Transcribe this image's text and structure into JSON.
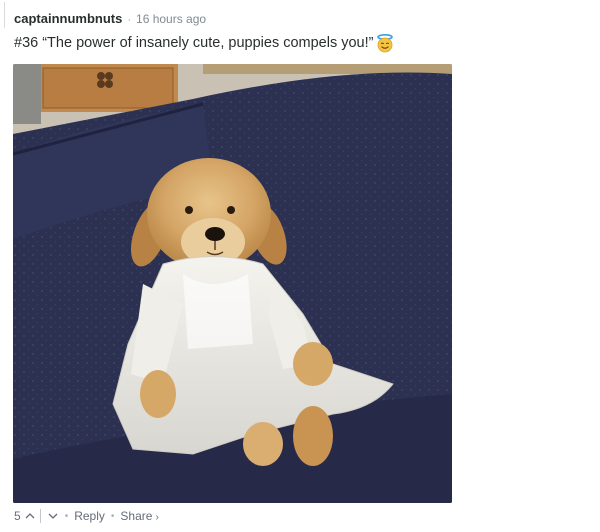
{
  "comment": {
    "author": "captainnumbnuts",
    "timestamp": "16 hours ago",
    "text": "#36 “The power of insanely cute, puppies compels you!”",
    "emoji_icon": "smiling-face-with-halo-icon"
  },
  "photo": {
    "subject_icon": "puppy-photo"
  },
  "actions": {
    "upvote_count": "5",
    "reply_label": "Reply",
    "share_label": "Share",
    "share_chevron": "›"
  },
  "colors": {
    "text": "#2a2e2e",
    "meta": "#7f8b91",
    "action": "#656c7a",
    "sofa": "#2b2f50"
  }
}
